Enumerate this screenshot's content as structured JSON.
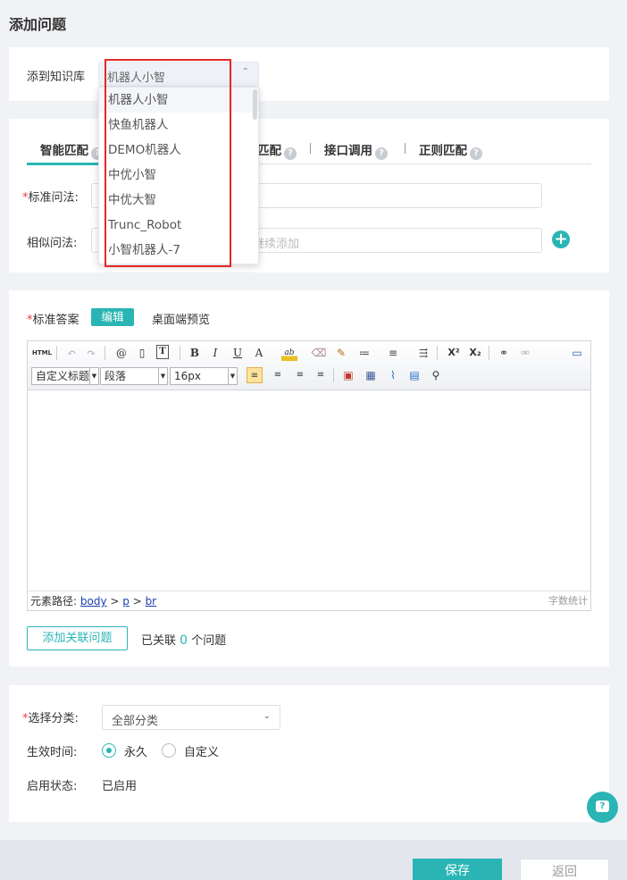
{
  "page": {
    "title": "添加问题"
  },
  "knowledge_base": {
    "label": "添到知识库",
    "selected": "机器人小智",
    "options": [
      "机器人小智",
      "快鱼机器人",
      "DEMO机器人",
      "中优小智",
      "中优大智",
      "Trunc_Robot",
      "小智机器人-7"
    ]
  },
  "match_tabs": [
    {
      "label": "智能匹配"
    },
    {
      "label": "匹配"
    },
    {
      "label": "接口调用"
    },
    {
      "label": "正则匹配"
    }
  ],
  "question_form": {
    "standard_label": "标准问法:",
    "similar_label": "相似问法:",
    "similar_placeholder": "继续添加",
    "required_mark": "*"
  },
  "answer": {
    "label": "标准答案",
    "edit_button": "编辑",
    "preview_label": "桌面端预览"
  },
  "editor": {
    "toolbar_row1": [
      "HTML",
      "↶",
      "↷",
      "@",
      "▯",
      "T",
      "B",
      "I",
      "U",
      "A",
      "ab",
      "⌫",
      "✎",
      "≔",
      "≡",
      "⇶",
      "X²",
      "X₂",
      "⚭",
      "⚮",
      "▭"
    ],
    "heading_combo": "自定义标题",
    "paragraph_combo": "段落",
    "fontsize_combo": "16px",
    "status_prefix": "元素路径:",
    "path": [
      "body",
      "p",
      "br"
    ],
    "word_count": "字数统计"
  },
  "related": {
    "add_button": "添加关联问题",
    "prefix": "已关联",
    "count": "0",
    "suffix": "个问题"
  },
  "category": {
    "label": "选择分类:",
    "value": "全部分类"
  },
  "effective_time": {
    "label": "生效时间:",
    "options": [
      "永久",
      "自定义"
    ],
    "selected": "永久"
  },
  "status": {
    "label": "启用状态:",
    "value": "已启用"
  },
  "actions": {
    "save": "保存",
    "back": "返回"
  },
  "colors": {
    "accent": "#2ab5b4",
    "highlight_box": "#e62727"
  }
}
